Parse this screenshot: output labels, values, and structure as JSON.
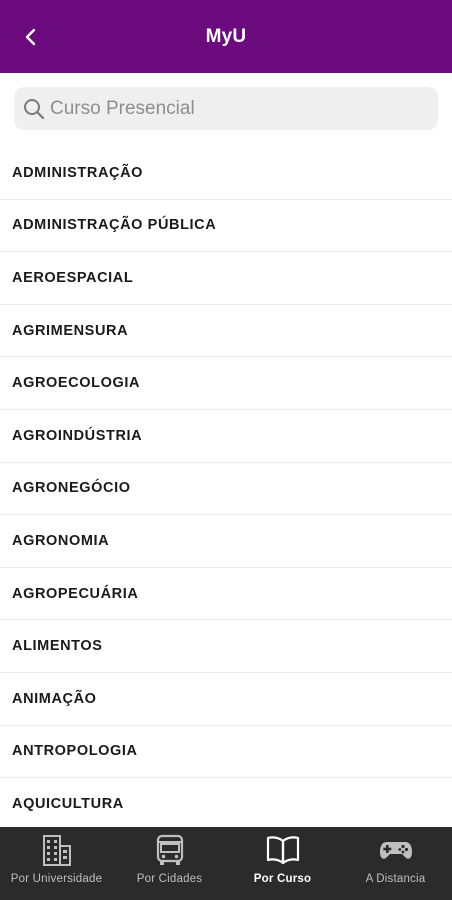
{
  "header": {
    "title": "MyU",
    "back_icon": "chevron-left-icon",
    "background_color": "#6b0b7d"
  },
  "search": {
    "placeholder": "Curso Presencial",
    "value": ""
  },
  "courses": [
    "ADMINISTRAÇÃO",
    "ADMINISTRAÇÃO PÚBLICA",
    "AEROESPACIAL",
    "AGRIMENSURA",
    "AGROECOLOGIA",
    "AGROINDÚSTRIA",
    "AGRONEGÓCIO",
    "AGRONOMIA",
    "AGROPECUÁRIA",
    "ALIMENTOS",
    "ANIMAÇÃO",
    "ANTROPOLOGIA",
    "AQUICULTURA"
  ],
  "tabbar": {
    "tabs": [
      {
        "label": "Por Universidade",
        "icon": "building-icon",
        "active": false
      },
      {
        "label": "Por Cidades",
        "icon": "bus-icon",
        "active": false
      },
      {
        "label": "Por Curso",
        "icon": "book-icon",
        "active": true
      },
      {
        "label": "A Distancia",
        "icon": "gamepad-icon",
        "active": false
      }
    ]
  }
}
